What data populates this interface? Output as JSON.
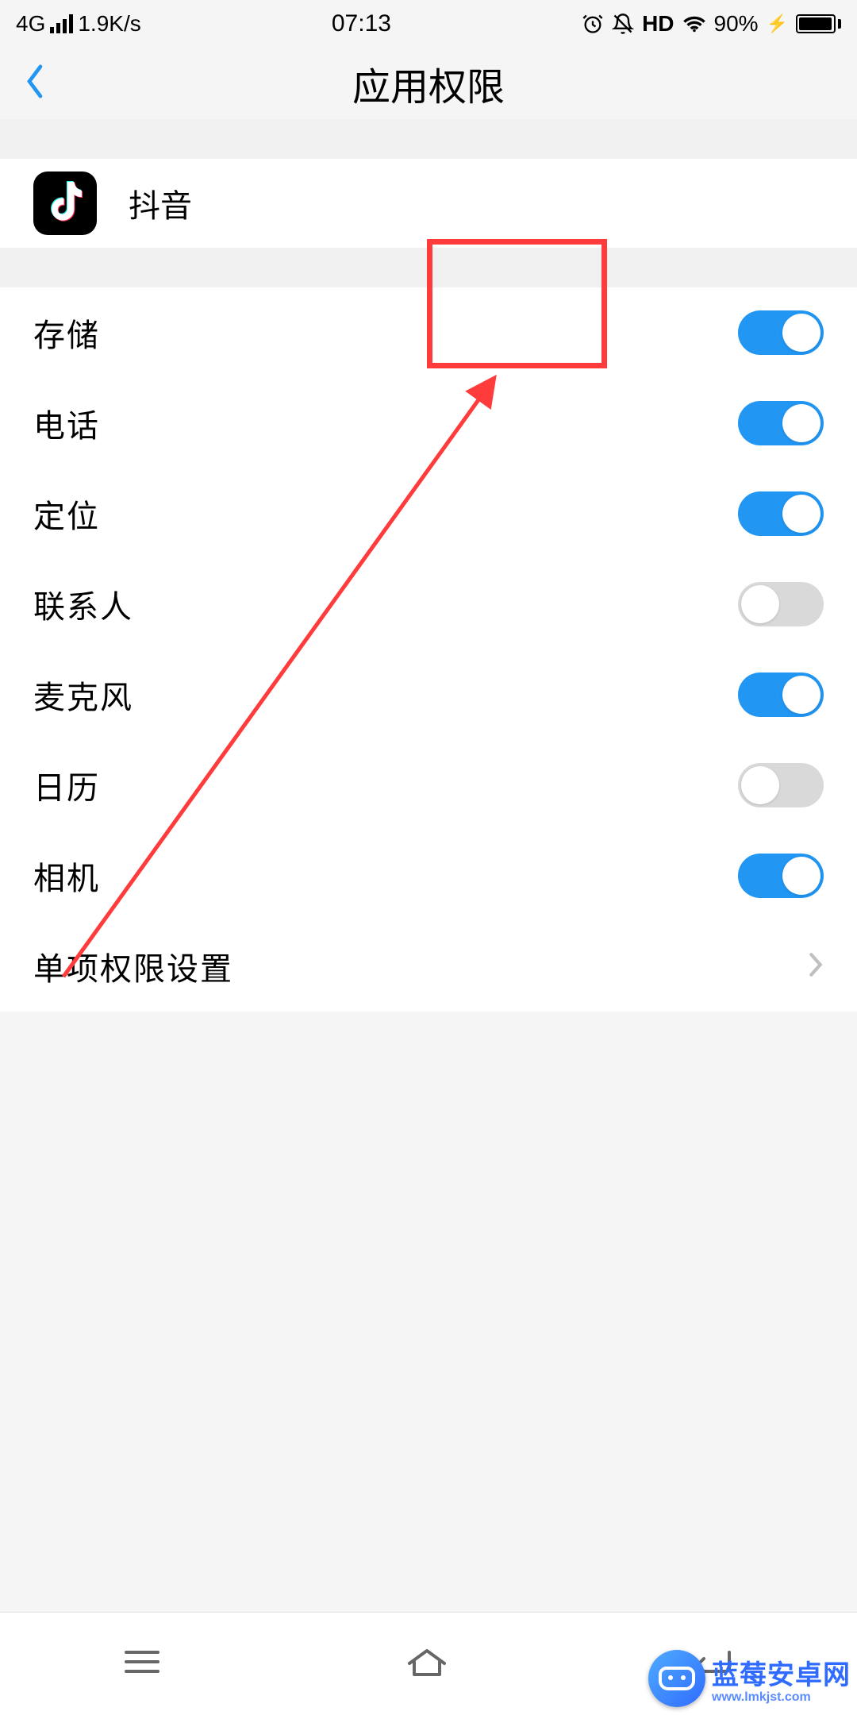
{
  "status": {
    "network": "4G",
    "speed": "1.9K/s",
    "time": "07:13",
    "hd": "HD",
    "battery_pct": "90%",
    "charging_glyph": "⚡"
  },
  "header": {
    "title": "应用权限"
  },
  "app": {
    "name": "抖音"
  },
  "permissions": [
    {
      "label": "存储",
      "on": true
    },
    {
      "label": "电话",
      "on": true
    },
    {
      "label": "定位",
      "on": true
    },
    {
      "label": "联系人",
      "on": false
    },
    {
      "label": "麦克风",
      "on": true
    },
    {
      "label": "日历",
      "on": false
    },
    {
      "label": "相机",
      "on": true
    }
  ],
  "advanced": {
    "label": "单项权限设置"
  },
  "watermark": {
    "main": "蓝莓安卓网",
    "sub": "www.lmkjst.com"
  },
  "colors": {
    "accent": "#2196f3",
    "annotation": "#ff3b3b"
  }
}
